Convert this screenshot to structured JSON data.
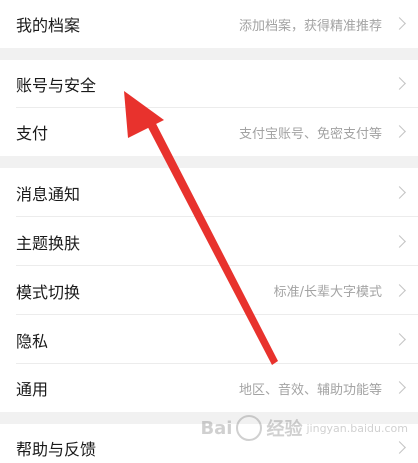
{
  "groups": [
    {
      "rows": [
        {
          "label": "我的档案",
          "value": "添加档案，获得精准推荐"
        }
      ]
    },
    {
      "rows": [
        {
          "label": "账号与安全",
          "value": ""
        },
        {
          "label": "支付",
          "value": "支付宝账号、免密支付等"
        }
      ]
    },
    {
      "rows": [
        {
          "label": "消息通知",
          "value": ""
        },
        {
          "label": "主题换肤",
          "value": ""
        },
        {
          "label": "模式切换",
          "value": "标准/长辈大字模式"
        },
        {
          "label": "隐私",
          "value": ""
        },
        {
          "label": "通用",
          "value": "地区、音效、辅助功能等"
        }
      ]
    },
    {
      "rows": [
        {
          "label": "帮助与反馈",
          "value": ""
        }
      ]
    }
  ],
  "watermark": {
    "brand": "Bai",
    "brand_end": "经验",
    "sub": "jingyan.baidu.com"
  },
  "colors": {
    "arrow": "#e8322d",
    "background": "#f1f1f1"
  }
}
